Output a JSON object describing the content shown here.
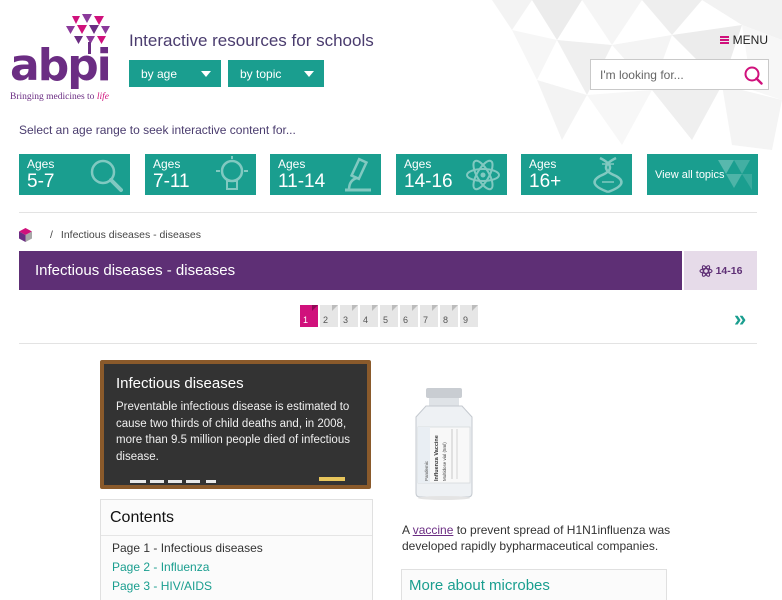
{
  "header": {
    "logo_text": "abpi",
    "logo_tagline_prefix": "Bringing medicines to ",
    "logo_tagline_emph": "life",
    "site_title": "Interactive resources for schools",
    "by_age_label": "by age",
    "by_topic_label": "by topic",
    "menu_label": "MENU",
    "search_placeholder": "I'm looking for..."
  },
  "age_selector": {
    "prompt": "Select an age range to seek interactive content for...",
    "tiles": [
      {
        "small": "Ages",
        "big": "5-7",
        "icon": "magnifier-icon"
      },
      {
        "small": "Ages",
        "big": "7-11",
        "icon": "lightbulb-icon"
      },
      {
        "small": "Ages",
        "big": "11-14",
        "icon": "microscope-icon"
      },
      {
        "small": "Ages",
        "big": "14-16",
        "icon": "atom-icon"
      },
      {
        "small": "Ages",
        "big": "16+",
        "icon": "dna-icon"
      }
    ],
    "view_all_label": "View all topics"
  },
  "breadcrumb": {
    "separator": "/",
    "current": "Infectious diseases - diseases"
  },
  "page": {
    "title": "Infectious diseases - diseases",
    "level": "14-16"
  },
  "pagination": {
    "pages": [
      "1",
      "2",
      "3",
      "4",
      "5",
      "6",
      "7",
      "8",
      "9"
    ],
    "current": "1",
    "next_label": "»"
  },
  "blackboard": {
    "title": "Infectious diseases",
    "text": "Preventable infectious disease is estimated to cause two thirds of child deaths and, in 2008, more than 9.5 million people died of infectious disease."
  },
  "contents": {
    "heading": "Contents",
    "items": [
      {
        "label": "Page 1 - Infectious diseases",
        "current": true
      },
      {
        "label": "Page 2 - Influenza",
        "current": false
      },
      {
        "label": "Page 3 - HIV/AIDS",
        "current": false
      }
    ]
  },
  "side": {
    "vial_label_1": "Pandemic",
    "vial_label_2": "Influenza Vaccine",
    "vial_label_3": "Multidose vial (5ml)",
    "caption_prefix": "A ",
    "caption_link": "vaccine",
    "caption_rest": " to prevent spread of H1N1influenza was developed rapidly bypharmaceutical companies.",
    "more_title": "More about microbes"
  },
  "colors": {
    "teal": "#1a9e8f",
    "purple": "#5e2f75",
    "magenta": "#d0117c",
    "logo_purple": "#6b2d83"
  }
}
